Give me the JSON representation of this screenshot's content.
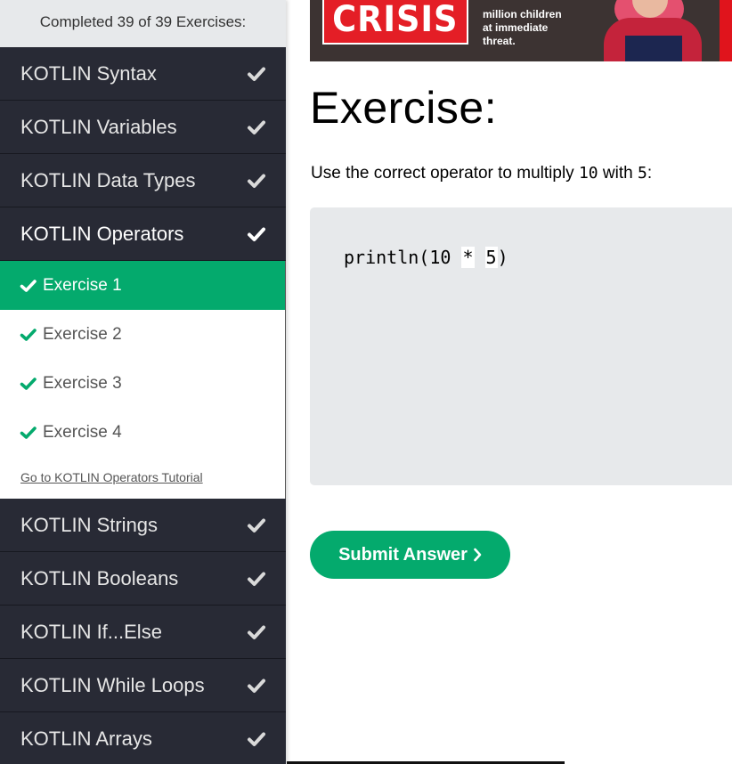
{
  "sidebar": {
    "progress_text": "Completed 39 of 39 Exercises:",
    "sections_top": [
      {
        "label": "KOTLIN Syntax"
      },
      {
        "label": "KOTLIN Variables"
      },
      {
        "label": "KOTLIN Data Types"
      },
      {
        "label": "KOTLIN Operators"
      }
    ],
    "exercises": [
      {
        "label": "Exercise 1"
      },
      {
        "label": "Exercise 2"
      },
      {
        "label": "Exercise 3"
      },
      {
        "label": "Exercise 4"
      }
    ],
    "tutorial_link": "Go to KOTLIN Operators Tutorial",
    "sections_bottom": [
      {
        "label": "KOTLIN Strings"
      },
      {
        "label": "KOTLIN Booleans"
      },
      {
        "label": "KOTLIN If...Else"
      },
      {
        "label": "KOTLIN While Loops"
      },
      {
        "label": "KOTLIN Arrays"
      }
    ]
  },
  "banner": {
    "headline": "CRISIS",
    "tagline": [
      "million children",
      "at immediate",
      "threat."
    ]
  },
  "main": {
    "title": "Exercise:",
    "instruction_prefix": "Use the correct operator to multiply ",
    "instruction_num1": "10",
    "instruction_mid": " with ",
    "instruction_num2": "5",
    "instruction_suffix": ":",
    "code_before": "println(10 ",
    "blank1_value": "*",
    "code_space": " ",
    "blank2_value": "5",
    "code_after": ")",
    "submit_label": "Submit Answer"
  },
  "colors": {
    "accent": "#04aa6d",
    "sidebar_bg": "#282a35",
    "code_bg": "#e7e9eb",
    "banner_red": "#e41e26"
  }
}
